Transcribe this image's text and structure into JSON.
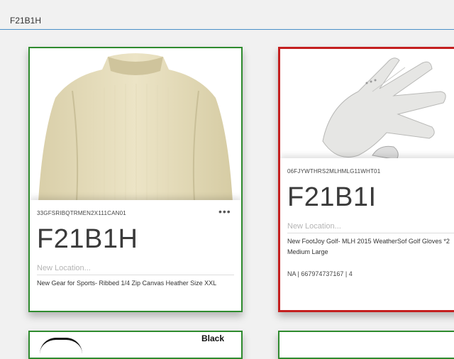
{
  "search": {
    "value": "F21B1H",
    "placeholder": ""
  },
  "cards": [
    {
      "sku": "33GFSRIBQTRMEN2X111CAN01",
      "code": "F21B1H",
      "location_placeholder": "New Location...",
      "description": "New Gear for Sports- Ribbed 1/4 Zip Canvas Heather Size XXL",
      "border_color": "#2e8b2e",
      "image": "sweater-back-image",
      "menu_icon": "more-horizontal-icon"
    },
    {
      "sku": "06FJYWTHRS2MLHMLG11WHT01",
      "code": "F21B1I",
      "location_placeholder": "New Location...",
      "description": "New FootJoy Golf- MLH 2015 WeatherSof Golf Gloves *2 Medium Large",
      "meta": "NA | 667974737167 | 4",
      "border_color": "#c41f1f",
      "image": "golf-glove-image"
    }
  ],
  "partial_cards": [
    {
      "label": "Black"
    }
  ]
}
